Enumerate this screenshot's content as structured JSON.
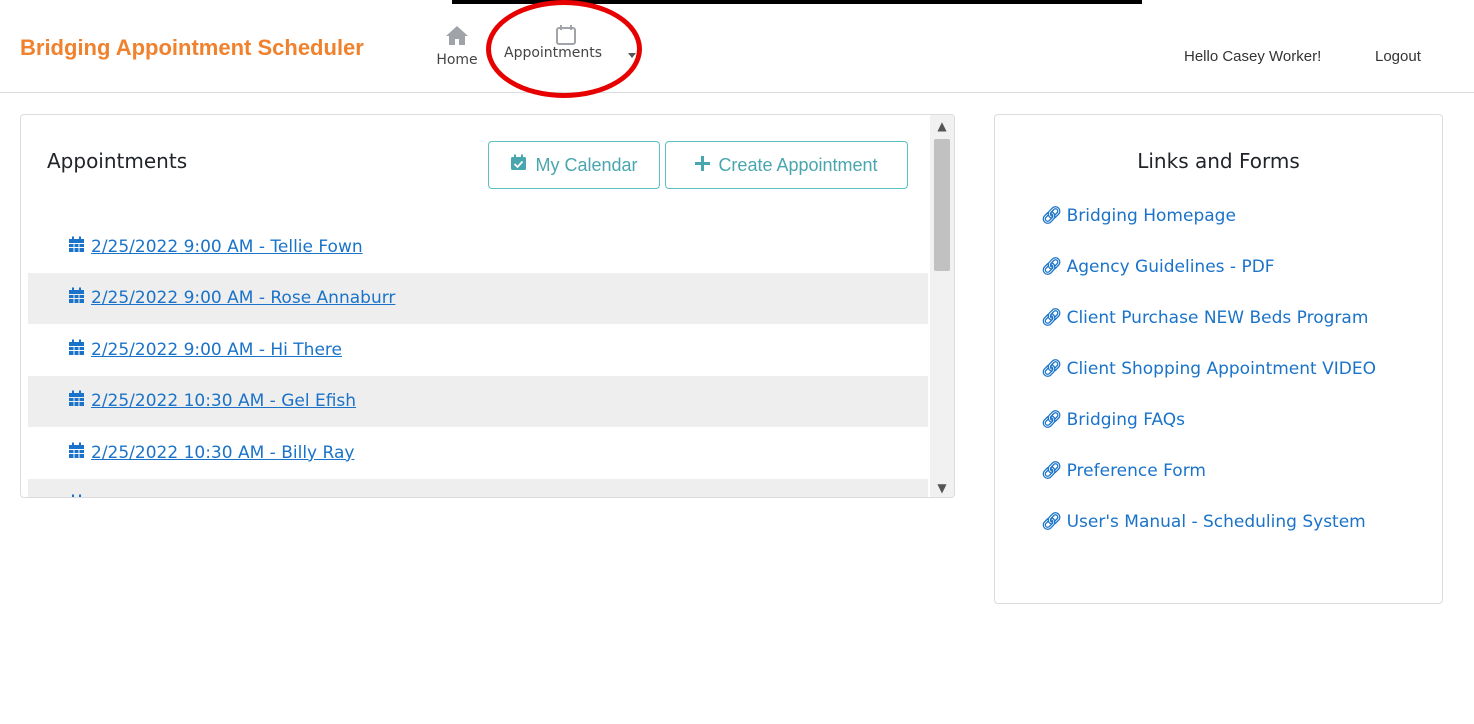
{
  "navbar": {
    "brand": "Bridging Appointment Scheduler",
    "home_label": "Home",
    "appointments_label": "Appointments",
    "greeting": "Hello Casey Worker!",
    "logout_label": "Logout"
  },
  "appointments": {
    "title": "Appointments",
    "my_calendar_label": "My Calendar",
    "create_label": "Create Appointment",
    "items": [
      {
        "label": "2/25/2022 9:00 AM - Tellie Fown"
      },
      {
        "label": "2/25/2022 9:00 AM - Rose Annaburr"
      },
      {
        "label": "2/25/2022 9:00 AM - Hi There"
      },
      {
        "label": "2/25/2022 10:30 AM - Gel Efish"
      },
      {
        "label": "2/25/2022 10:30 AM - Billy Ray"
      }
    ]
  },
  "links_card": {
    "title": "Links and Forms",
    "links": [
      {
        "label": "Bridging Homepage"
      },
      {
        "label": "Agency Guidelines - PDF"
      },
      {
        "label": "Client Purchase NEW Beds Program"
      },
      {
        "label": "Client Shopping Appointment VIDEO"
      },
      {
        "label": "Bridging FAQs"
      },
      {
        "label": "Preference Form"
      },
      {
        "label": "User's Manual - Scheduling System"
      }
    ]
  },
  "colors": {
    "brand": "#f0812d",
    "link": "#1a73c9",
    "outline_button": "#5bc0c4",
    "annotation_circle": "#e60000"
  },
  "icons": {
    "home": "home-icon",
    "calendar": "calendar-icon",
    "calendar_check": "calendar-check-icon",
    "plus": "plus-icon",
    "link": "link-icon"
  }
}
